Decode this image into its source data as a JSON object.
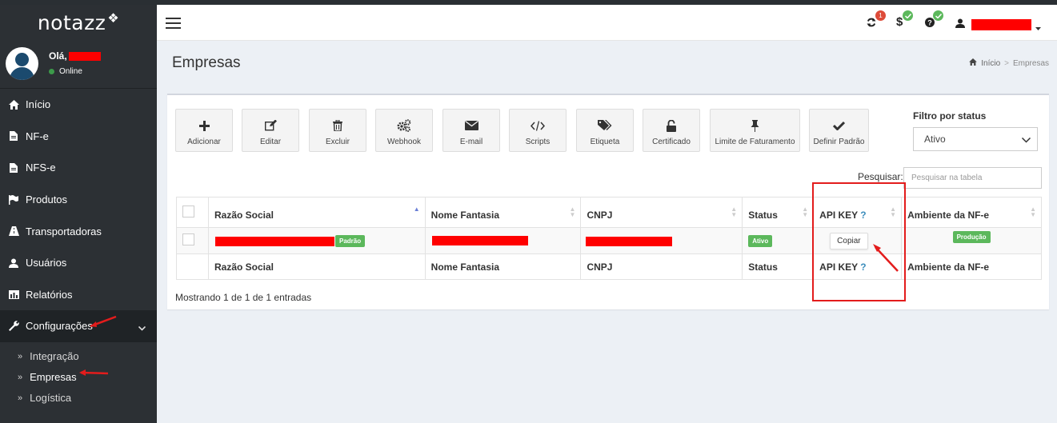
{
  "app": {
    "logo_text": "notazz"
  },
  "user": {
    "greeting": "Olá,",
    "status": "Online"
  },
  "sidebar": {
    "items": [
      {
        "label": "Início",
        "icon": "home-icon"
      },
      {
        "label": "NF-e",
        "icon": "file-icon"
      },
      {
        "label": "NFS-e",
        "icon": "file-icon"
      },
      {
        "label": "Produtos",
        "icon": "flag-icon"
      },
      {
        "label": "Transportadoras",
        "icon": "road-icon"
      },
      {
        "label": "Usuários",
        "icon": "user-icon"
      },
      {
        "label": "Relatórios",
        "icon": "chart-icon"
      },
      {
        "label": "Configurações",
        "icon": "wrench-icon"
      }
    ],
    "submenu": [
      {
        "label": "Integração"
      },
      {
        "label": "Empresas"
      },
      {
        "label": "Logística"
      }
    ]
  },
  "topbar": {
    "sync_badge": "1"
  },
  "header": {
    "title": "Empresas",
    "breadcrumb": {
      "home": "Início",
      "current": "Empresas"
    }
  },
  "toolbar": {
    "buttons": [
      {
        "label": "Adicionar",
        "icon": "plus-icon"
      },
      {
        "label": "Editar",
        "icon": "edit-icon"
      },
      {
        "label": "Excluir",
        "icon": "trash-icon"
      },
      {
        "label": "Webhook",
        "icon": "gears-icon"
      },
      {
        "label": "E-mail",
        "icon": "envelope-icon"
      },
      {
        "label": "Scripts",
        "icon": "code-icon"
      },
      {
        "label": "Etiqueta",
        "icon": "tags-icon"
      },
      {
        "label": "Certificado",
        "icon": "unlock-icon"
      },
      {
        "label": "Limite de Faturamento",
        "icon": "pin-icon"
      },
      {
        "label": "Definir Padrão",
        "icon": "check-icon"
      }
    ]
  },
  "filter": {
    "label": "Filtro por status",
    "selected": "Ativo"
  },
  "search": {
    "label": "Pesquisar:",
    "placeholder": "Pesquisar na tabela"
  },
  "table": {
    "columns": [
      "Razão Social",
      "Nome Fantasia",
      "CNPJ",
      "Status",
      "API KEY",
      "Ambiente da NF-e"
    ],
    "api_key_help": "?",
    "row": {
      "badge_padrao": "Padrão",
      "status": "Ativo",
      "copy_label": "Copiar",
      "ambiente": "Produção"
    }
  },
  "info": "Mostrando 1 de 1 de 1 entradas"
}
